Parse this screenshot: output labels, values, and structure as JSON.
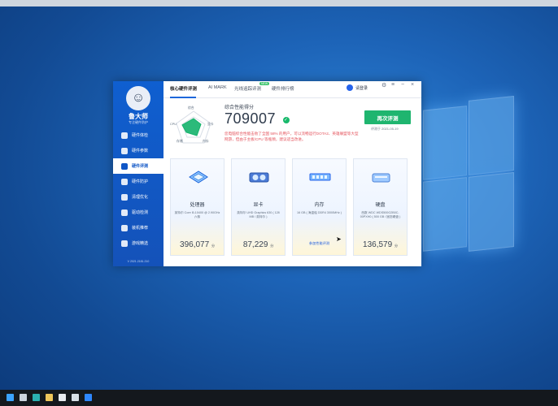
{
  "sidebar": {
    "brand": "鲁大师",
    "brand_sub": "专注硬件防护",
    "items": [
      {
        "label": "硬件体检"
      },
      {
        "label": "硬件参数"
      },
      {
        "label": "硬件评测"
      },
      {
        "label": "硬件防护"
      },
      {
        "label": "清理优化"
      },
      {
        "label": "驱动检测"
      },
      {
        "label": "装机推荐"
      },
      {
        "label": "游戏精选"
      }
    ],
    "version": "V 2021.2181.210"
  },
  "topbar": {
    "tabs": [
      {
        "label": "核心硬件评测"
      },
      {
        "label": "AI MARK"
      },
      {
        "label": "光线追踪评测"
      },
      {
        "label": "硬件排行榜"
      }
    ],
    "new_badge": "NEW",
    "user_name": "请登录"
  },
  "radar": {
    "labels": {
      "top": "综合",
      "left": "CPU",
      "right": "显卡",
      "bottom_left": "存储",
      "bottom_right": "内存"
    }
  },
  "score": {
    "label": "综合性能得分",
    "value": "709007",
    "desc": "您电脑综合性能击败了全国 58% 的用户，可以流畅运行DOTA2、英雄联盟等大型网游，但由于主板/CPU 等瓶颈，建议适当改进。"
  },
  "retest": {
    "label": "再次评测",
    "time": "评测于 2021-05-19"
  },
  "cards": [
    {
      "name": "处理器",
      "desc": "英特尔 Core i5-10400 @ 2.90GHz 六核",
      "score": "396,077",
      "unit": "分"
    },
    {
      "name": "显卡",
      "desc": "英特尔 UHD Graphics 630 ( 128 MB / 英特尔 )",
      "score": "87,229",
      "unit": "分"
    },
    {
      "name": "内存",
      "desc": "16 GB ( 海盗船 DDR4 3000MHz )",
      "link": "参加性能评测"
    },
    {
      "name": "硬盘",
      "desc": "西数 WDC WDS500G2B0C-00PXH0 ( 500 GB / 固态硬盘 )",
      "score": "136,579",
      "unit": "分"
    }
  ],
  "colors": {
    "primary": "#1d67db",
    "sidebar": "#1452b9",
    "success": "#1fb56f",
    "warning_text": "#e4525b"
  }
}
